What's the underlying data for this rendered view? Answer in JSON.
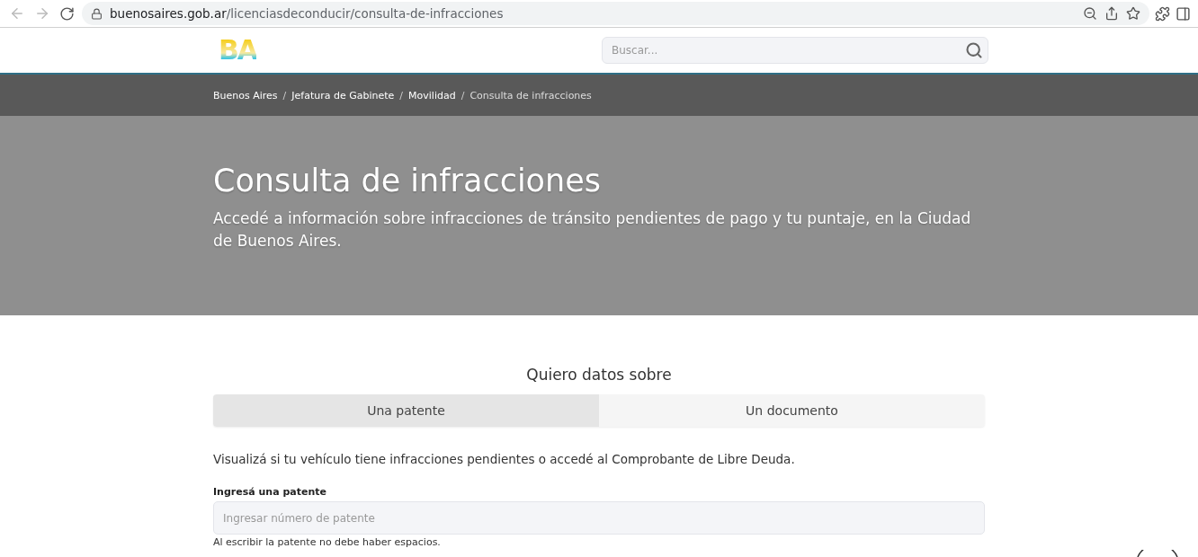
{
  "browser": {
    "url_host": "buenosaires.gob.ar",
    "url_path": "/licenciasdeconducir/consulta-de-infracciones"
  },
  "header": {
    "logo": "BA",
    "search": {
      "placeholder": "Buscar..."
    }
  },
  "breadcrumb_separator": "/",
  "breadcrumb": [
    {
      "label": "Buenos Aires",
      "current": false
    },
    {
      "label": "Jefatura de Gabinete",
      "current": false
    },
    {
      "label": "Movilidad",
      "current": false
    },
    {
      "label": "Consulta de infracciones",
      "current": true
    }
  ],
  "hero": {
    "title": "Consulta de infracciones",
    "subtitle": "Accedé a información sobre infracciones de tránsito pendientes de pago y tu puntaje, en la Ciudad de Buenos Aires."
  },
  "form": {
    "heading": "Quiero datos sobre",
    "tabs": [
      {
        "label": "Una patente",
        "selected": true
      },
      {
        "label": "Un documento",
        "selected": false
      }
    ],
    "description": "Visualizá si tu vehículo tiene infracciones pendientes o accedé al Comprobante de Libre Deuda.",
    "field": {
      "label": "Ingresá una patente",
      "placeholder": "Ingresar número de patente",
      "hint": "Al escribir la patente no debe haber espacios."
    }
  }
}
